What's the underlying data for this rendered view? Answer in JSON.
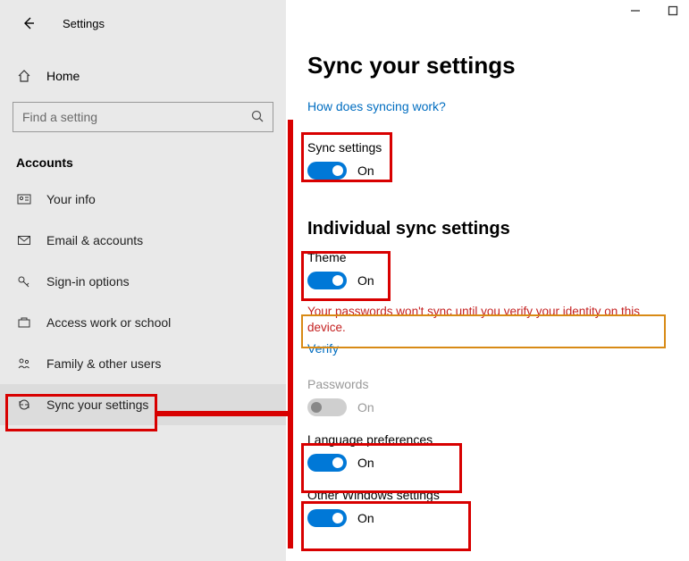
{
  "app_title": "Settings",
  "window_controls": {
    "minimize": "minimize",
    "maximize": "maximize"
  },
  "sidebar": {
    "home_label": "Home",
    "search_placeholder": "Find a setting",
    "section_title": "Accounts",
    "items": [
      {
        "icon": "user-card-icon",
        "label": "Your info"
      },
      {
        "icon": "mail-icon",
        "label": "Email & accounts"
      },
      {
        "icon": "key-icon",
        "label": "Sign-in options"
      },
      {
        "icon": "briefcase-icon",
        "label": "Access work or school"
      },
      {
        "icon": "family-icon",
        "label": "Family & other users"
      },
      {
        "icon": "sync-icon",
        "label": "Sync your settings"
      }
    ]
  },
  "page": {
    "title": "Sync your settings",
    "help_link": "How does syncing work?",
    "sync_settings": {
      "label": "Sync settings",
      "state": "On"
    },
    "individual_title": "Individual sync settings",
    "theme": {
      "label": "Theme",
      "state": "On"
    },
    "warning": "Your passwords won't sync until you verify your identity on this device.",
    "verify": "Verify",
    "passwords": {
      "label": "Passwords",
      "state": "On"
    },
    "language": {
      "label": "Language preferences",
      "state": "On"
    },
    "other": {
      "label": "Other Windows settings",
      "state": "On"
    }
  }
}
